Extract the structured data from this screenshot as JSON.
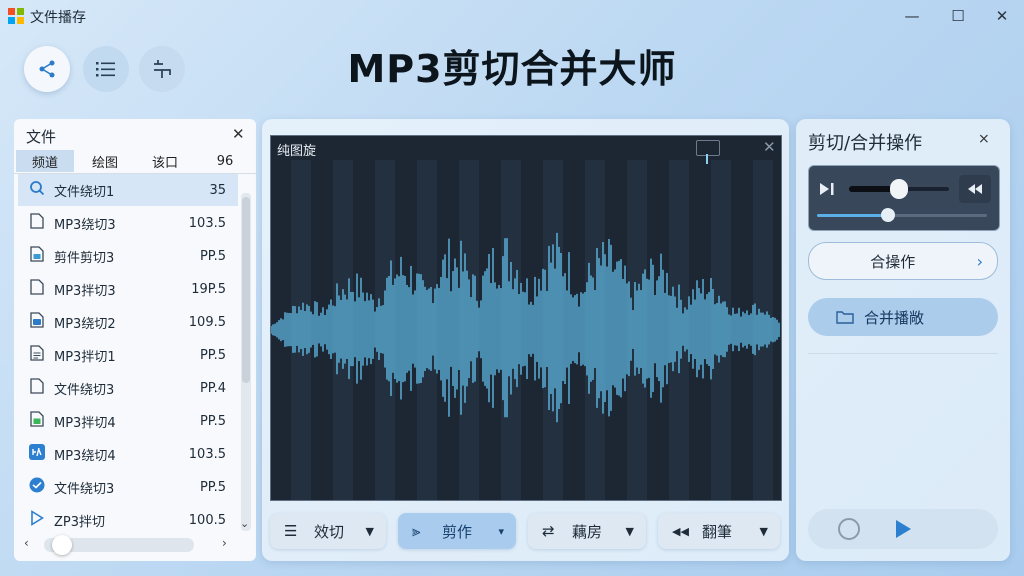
{
  "window": {
    "title": "文件播存",
    "minimize": "—",
    "maximize": "☐",
    "close": "✕"
  },
  "toolbar": {
    "share_icon": "share-icon",
    "list_icon": "list-icon",
    "fold_icon": "fold-icon"
  },
  "main_title": "MP3剪切合并大师",
  "files_panel": {
    "title": "文件",
    "close": "✕",
    "tabs": [
      "频道",
      "绘图",
      "该口",
      "96"
    ],
    "rows": [
      {
        "icon": "search-icon",
        "name": "文件绕切1",
        "size": "35"
      },
      {
        "icon": "file-icon",
        "name": "MP3绕切3",
        "size": "103.5"
      },
      {
        "icon": "file-image-icon",
        "name": "剪件剪切3",
        "size": "PP.5"
      },
      {
        "icon": "file-icon",
        "name": "MP3拌切3",
        "size": "19P.5"
      },
      {
        "icon": "file-audio-icon",
        "name": "MP3绕切2",
        "size": "109.5"
      },
      {
        "icon": "file-text-icon",
        "name": "MP3拌切1",
        "size": "PP.5"
      },
      {
        "icon": "file-icon",
        "name": "文件绕切3",
        "size": "PP.4"
      },
      {
        "icon": "file-green-icon",
        "name": "MP3拌切4",
        "size": "PP.5"
      },
      {
        "icon": "app-icon",
        "name": "MP3绕切4",
        "size": "103.5"
      },
      {
        "icon": "circle-arrow-icon",
        "name": "文件绕切3",
        "size": "PP.5"
      },
      {
        "icon": "play-outline-icon",
        "name": "ZP3拌切",
        "size": "100.5"
      }
    ]
  },
  "waveform": {
    "title": "纯图旋",
    "close": "✕"
  },
  "center_buttons": [
    {
      "icon": "☰",
      "label": "效切",
      "chev": "▼"
    },
    {
      "icon": "⫸",
      "label": "剪作",
      "chev": "▾"
    },
    {
      "icon": "⇄",
      "label": "藕房",
      "chev": "▼"
    },
    {
      "icon": "◀◀",
      "label": "翻筆",
      "chev": "▼"
    }
  ],
  "ops_panel": {
    "title": "剪切/合并操作",
    "collapse": "⨯",
    "merge_ops_label": "合操作",
    "merge_ops_chev": "›",
    "merge_play_label": "合并播敞"
  },
  "player": {
    "volume_level": 0.45,
    "progress": 0.42
  },
  "colors": {
    "accent": "#4a9fd8",
    "wave": "#5fb8e2",
    "primary_button": "#acccec",
    "dark_panel": "#1d2734"
  }
}
